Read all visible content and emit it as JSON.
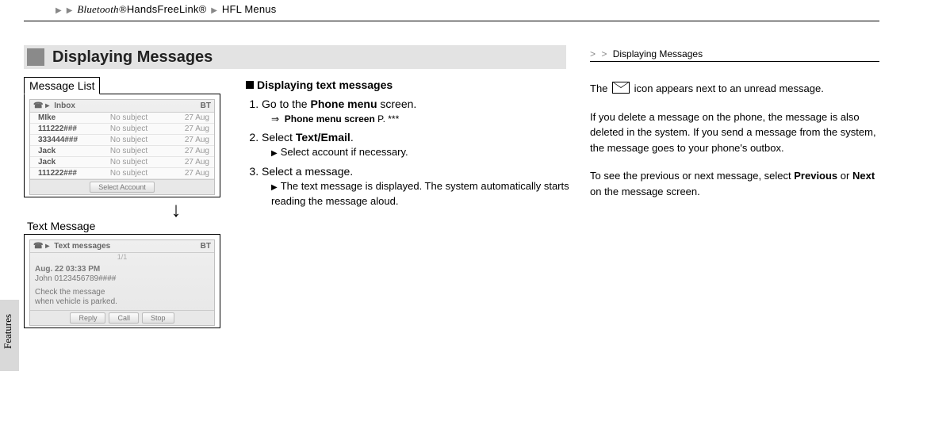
{
  "breadcrumb": {
    "seg1": "Bluetooth®",
    "seg2": "HandsFreeLink®",
    "seg3": "HFL Menus"
  },
  "heading": "Displaying Messages",
  "left": {
    "label_list": "Message List",
    "inbox_title": "Inbox",
    "bt_label": "BT",
    "rows": [
      {
        "name": "MIke",
        "subj": "No subject",
        "date": "27 Aug"
      },
      {
        "name": "111222###",
        "subj": "No subject",
        "date": "27 Aug"
      },
      {
        "name": "333444###",
        "subj": "No subject",
        "date": "27 Aug"
      },
      {
        "name": "Jack",
        "subj": "No subject",
        "date": "27 Aug"
      },
      {
        "name": "Jack",
        "subj": "No subject",
        "date": "27 Aug"
      },
      {
        "name": "111222###",
        "subj": "No subject",
        "date": "27 Aug"
      }
    ],
    "select_account": "Select Account",
    "label_text": "Text  Message",
    "tm_title": "Text messages",
    "tm_count": "1/1",
    "tm_date": "Aug. 22 03:33 PM",
    "tm_from": "John 0123456789####",
    "tm_body1": "Check the message",
    "tm_body2": "when vehicle is parked.",
    "btn_reply": "Reply",
    "btn_call": "Call",
    "btn_stop": "Stop"
  },
  "instr": {
    "title": "Displaying text messages",
    "s1a": "Go to the ",
    "s1b": "Phone menu",
    "s1c": " screen.",
    "ref_a": "Phone menu screen",
    "ref_b": "P. ***",
    "s2a": "Select ",
    "s2b": "Text/Email",
    "s2c": ".",
    "s2sub": "Select account if necessary.",
    "s3": "Select a message.",
    "s3sub": "The text message is displayed. The system automatically starts reading the message aloud."
  },
  "right": {
    "crumb": "Displaying Messages",
    "p1a": "The ",
    "p1b": " icon appears next to an unread message.",
    "p2": "If you delete a message on the phone, the message is also deleted in the system. If you send a message from the system, the message goes to your phone's outbox.",
    "p3a": "To see the previous or next message, select ",
    "p3b": "Previous",
    "p3c": " or ",
    "p3d": "Next",
    "p3e": " on the message screen."
  },
  "sidetab": "Features"
}
